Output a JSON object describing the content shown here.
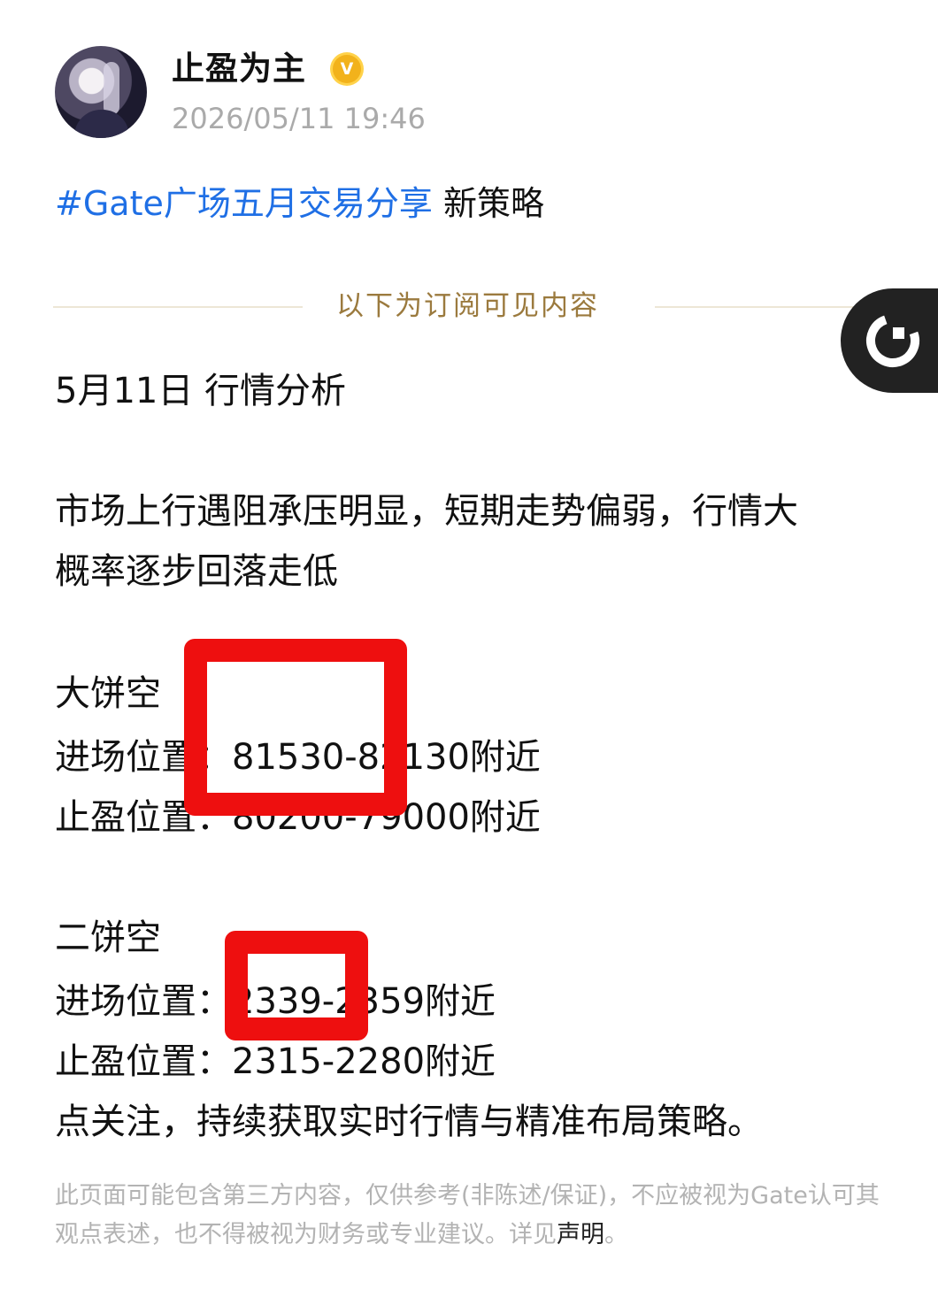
{
  "post": {
    "author": "止盈为主",
    "verified_badge": "V",
    "timestamp": "2026/05/11 19:46",
    "hashtag": "#Gate广场五月交易分享",
    "title_suffix": " 新策略",
    "subscription_divider": "以下为订阅可见内容"
  },
  "content": {
    "heading": "5月11日 行情分析",
    "analysis_line1": "市场上行遇阻承压明显，短期走势偏弱，行情大",
    "analysis_line2": "概率逐步回落走低",
    "btc": {
      "title": "大饼空",
      "entry": "进场位置：81530-82130附近",
      "take_profit": "止盈位置：80200-79000附近"
    },
    "eth": {
      "title": "二饼空",
      "entry": "进场位置：2339-2359附近",
      "take_profit": "止盈位置：2315-2280附近"
    },
    "call_to_action": "点关注，持续获取实时行情与精准布局策略。"
  },
  "disclaimer": {
    "text": "此页面可能包含第三方内容，仅供参考(非陈述/保证)，不应被视为Gate认可其观点表述，也不得被视为财务或专业建议。详见",
    "link": "声明",
    "end": "。"
  },
  "icons": {
    "float_button": "refresh-icon"
  },
  "colors": {
    "hashtag": "#1f6fe5",
    "divider_label": "#9b7a3e",
    "highlight_box": "#ee0f0f",
    "badge": "#f2b21b"
  }
}
